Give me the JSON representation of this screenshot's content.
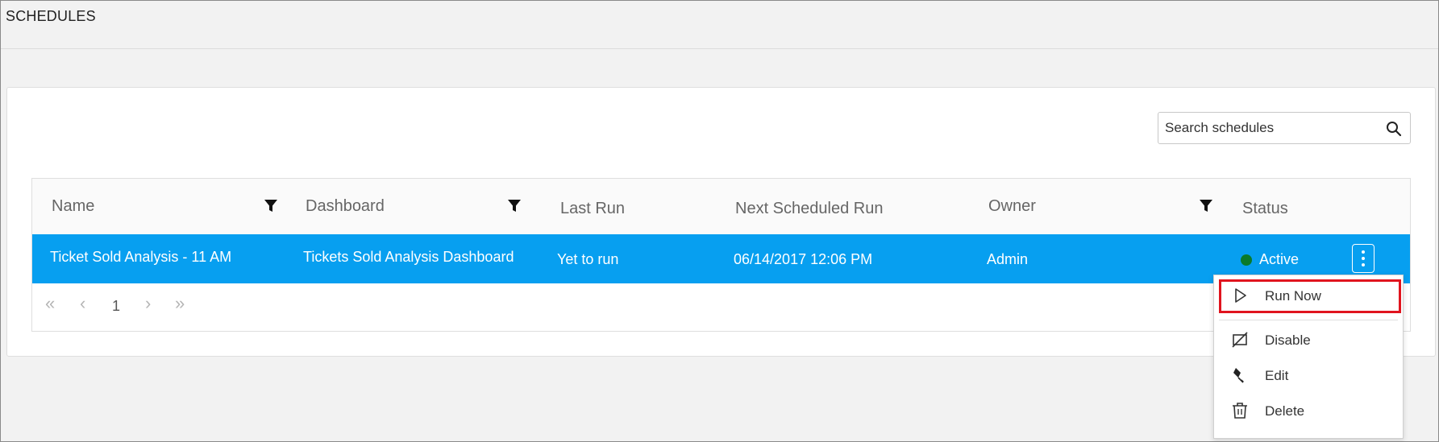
{
  "page": {
    "title": "SCHEDULES"
  },
  "search": {
    "placeholder": "Search schedules",
    "value": ""
  },
  "grid": {
    "columns": [
      {
        "label": "Name",
        "filterable": true
      },
      {
        "label": "Dashboard",
        "filterable": true
      },
      {
        "label": "Last Run",
        "filterable": false
      },
      {
        "label": "Next Scheduled Run",
        "filterable": false
      },
      {
        "label": "Owner",
        "filterable": true
      },
      {
        "label": "Status",
        "filterable": false
      }
    ],
    "rows": [
      {
        "name": "Ticket Sold Analysis - 11 AM",
        "dashboard": "Tickets Sold Analysis Dashboard",
        "last_run": "Yet to run",
        "next_run": "06/14/2017 12:06 PM",
        "owner": "Admin",
        "status": "Active",
        "status_color": "#0a7a2a",
        "selected": true
      }
    ],
    "row_highlight_color": "#079ff0"
  },
  "pager": {
    "current_page": "1"
  },
  "context_menu": {
    "items": [
      {
        "label": "Run Now",
        "icon": "play-icon",
        "highlighted": true
      },
      {
        "label": "Disable",
        "icon": "disable-icon"
      },
      {
        "label": "Edit",
        "icon": "pencil-icon"
      },
      {
        "label": "Delete",
        "icon": "trash-icon"
      }
    ],
    "highlight_color": "#e0141e"
  }
}
